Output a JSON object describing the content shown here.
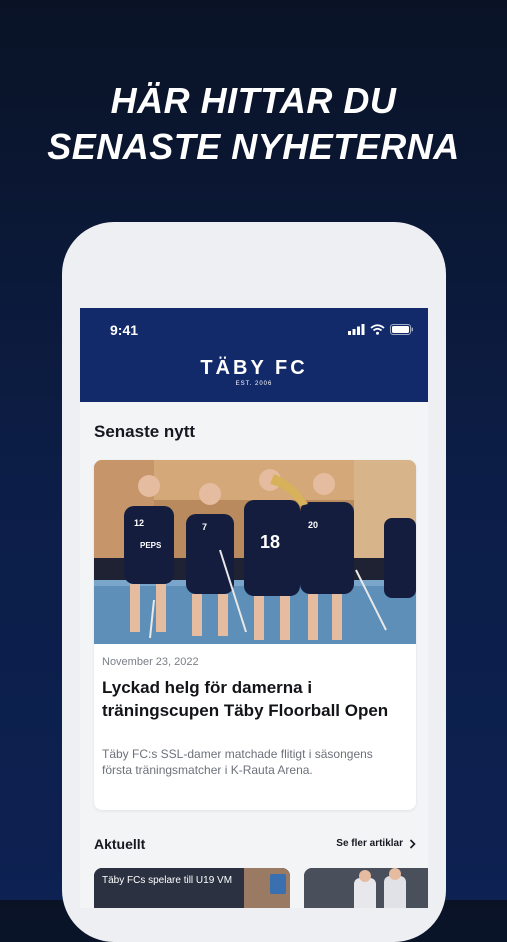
{
  "headline": {
    "line1": "HÄR HITTAR DU",
    "line2": "SENASTE NYHETERNA"
  },
  "status_bar": {
    "time": "9:41"
  },
  "brand": {
    "name": "TÄBY FC",
    "established": "EST. 2006"
  },
  "latest": {
    "section_title": "Senaste nytt",
    "article": {
      "date": "November 23, 2022",
      "title": "Lyckad helg för damerna i träningscupen Täby Floorball Open",
      "excerpt": "Täby FC:s SSL-damer matchade flitigt i säsongens första träningsmatcher i K-Rauta Arena.",
      "jersey_numbers": [
        "12",
        "7",
        "18",
        "20"
      ],
      "sponsor_text": "PEPS"
    }
  },
  "current": {
    "section_title": "Aktuellt",
    "see_more_label": "Se fler artiklar",
    "tiles": [
      {
        "caption": "Täby FCs spelare till U19 VM"
      },
      {
        "caption": ""
      }
    ]
  },
  "colors": {
    "header_blue": "#132a6a",
    "background_navy": "#0c1e48",
    "card_white": "#ffffff"
  }
}
